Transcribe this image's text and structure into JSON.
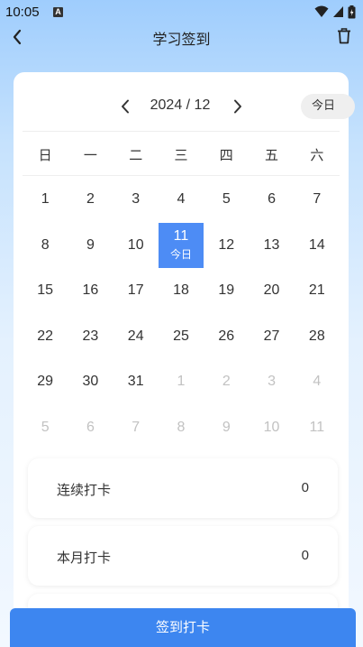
{
  "status": {
    "time": "10:05",
    "a_badge": "A"
  },
  "header": {
    "title": "学习签到"
  },
  "calendar": {
    "month_label": "2024 / 12",
    "today_label": "今日",
    "weekdays": [
      "日",
      "一",
      "二",
      "三",
      "四",
      "五",
      "六"
    ],
    "weeks": [
      [
        {
          "d": "1"
        },
        {
          "d": "2"
        },
        {
          "d": "3"
        },
        {
          "d": "4"
        },
        {
          "d": "5"
        },
        {
          "d": "6"
        },
        {
          "d": "7"
        }
      ],
      [
        {
          "d": "8"
        },
        {
          "d": "9"
        },
        {
          "d": "10"
        },
        {
          "d": "11",
          "sub": "今日",
          "selected": true
        },
        {
          "d": "12"
        },
        {
          "d": "13"
        },
        {
          "d": "14"
        }
      ],
      [
        {
          "d": "15"
        },
        {
          "d": "16"
        },
        {
          "d": "17"
        },
        {
          "d": "18"
        },
        {
          "d": "19"
        },
        {
          "d": "20"
        },
        {
          "d": "21"
        }
      ],
      [
        {
          "d": "22"
        },
        {
          "d": "23"
        },
        {
          "d": "24"
        },
        {
          "d": "25"
        },
        {
          "d": "26"
        },
        {
          "d": "27"
        },
        {
          "d": "28"
        }
      ],
      [
        {
          "d": "29"
        },
        {
          "d": "30"
        },
        {
          "d": "31"
        },
        {
          "d": "1",
          "other": true
        },
        {
          "d": "2",
          "other": true
        },
        {
          "d": "3",
          "other": true
        },
        {
          "d": "4",
          "other": true
        }
      ],
      [
        {
          "d": "5",
          "other": true
        },
        {
          "d": "6",
          "other": true
        },
        {
          "d": "7",
          "other": true
        },
        {
          "d": "8",
          "other": true
        },
        {
          "d": "9",
          "other": true
        },
        {
          "d": "10",
          "other": true
        },
        {
          "d": "11",
          "other": true
        }
      ]
    ]
  },
  "stats": {
    "streak": {
      "label": "连续打卡",
      "value": "0"
    },
    "month": {
      "label": "本月打卡",
      "value": "0"
    }
  },
  "checkin": {
    "label": "签到打卡"
  },
  "colors": {
    "accent": "#3d86f0",
    "selected": "#4d8cf5"
  }
}
